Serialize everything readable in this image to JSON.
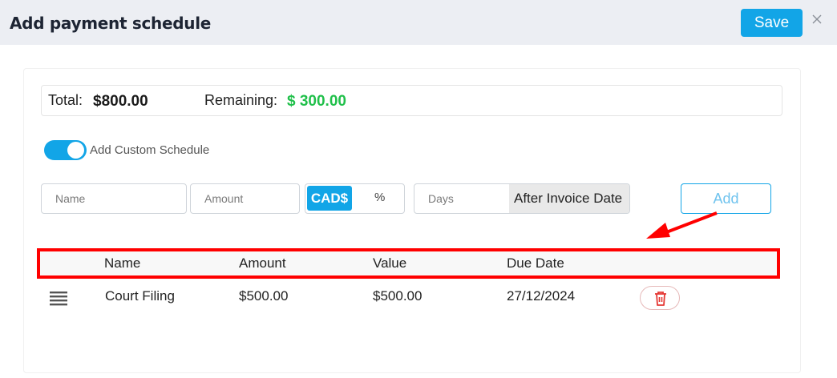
{
  "header": {
    "title": "Add payment schedule",
    "save_label": "Save",
    "close_icon": "close-icon"
  },
  "totals": {
    "total_label": "Total:",
    "total_value": "$800.00",
    "remaining_label": "Remaining:",
    "remaining_value": "$ 300.00"
  },
  "custom_schedule": {
    "label": "Add Custom Schedule",
    "enabled": true
  },
  "form": {
    "name_placeholder": "Name",
    "amount_placeholder": "Amount",
    "currency_option": "CAD$",
    "percent_option": "%",
    "days_placeholder": "Days",
    "after_label": "After Invoice Date",
    "add_label": "Add"
  },
  "table": {
    "columns": [
      "Name",
      "Amount",
      "Value",
      "Due Date"
    ],
    "rows": [
      {
        "name": "Court Filing",
        "amount": "$500.00",
        "value": "$500.00",
        "due_date": "27/12/2024"
      }
    ]
  },
  "colors": {
    "accent": "#12a5e7",
    "remaining": "#21c04b",
    "highlight": "#ff0000",
    "delete": "#e53935"
  }
}
